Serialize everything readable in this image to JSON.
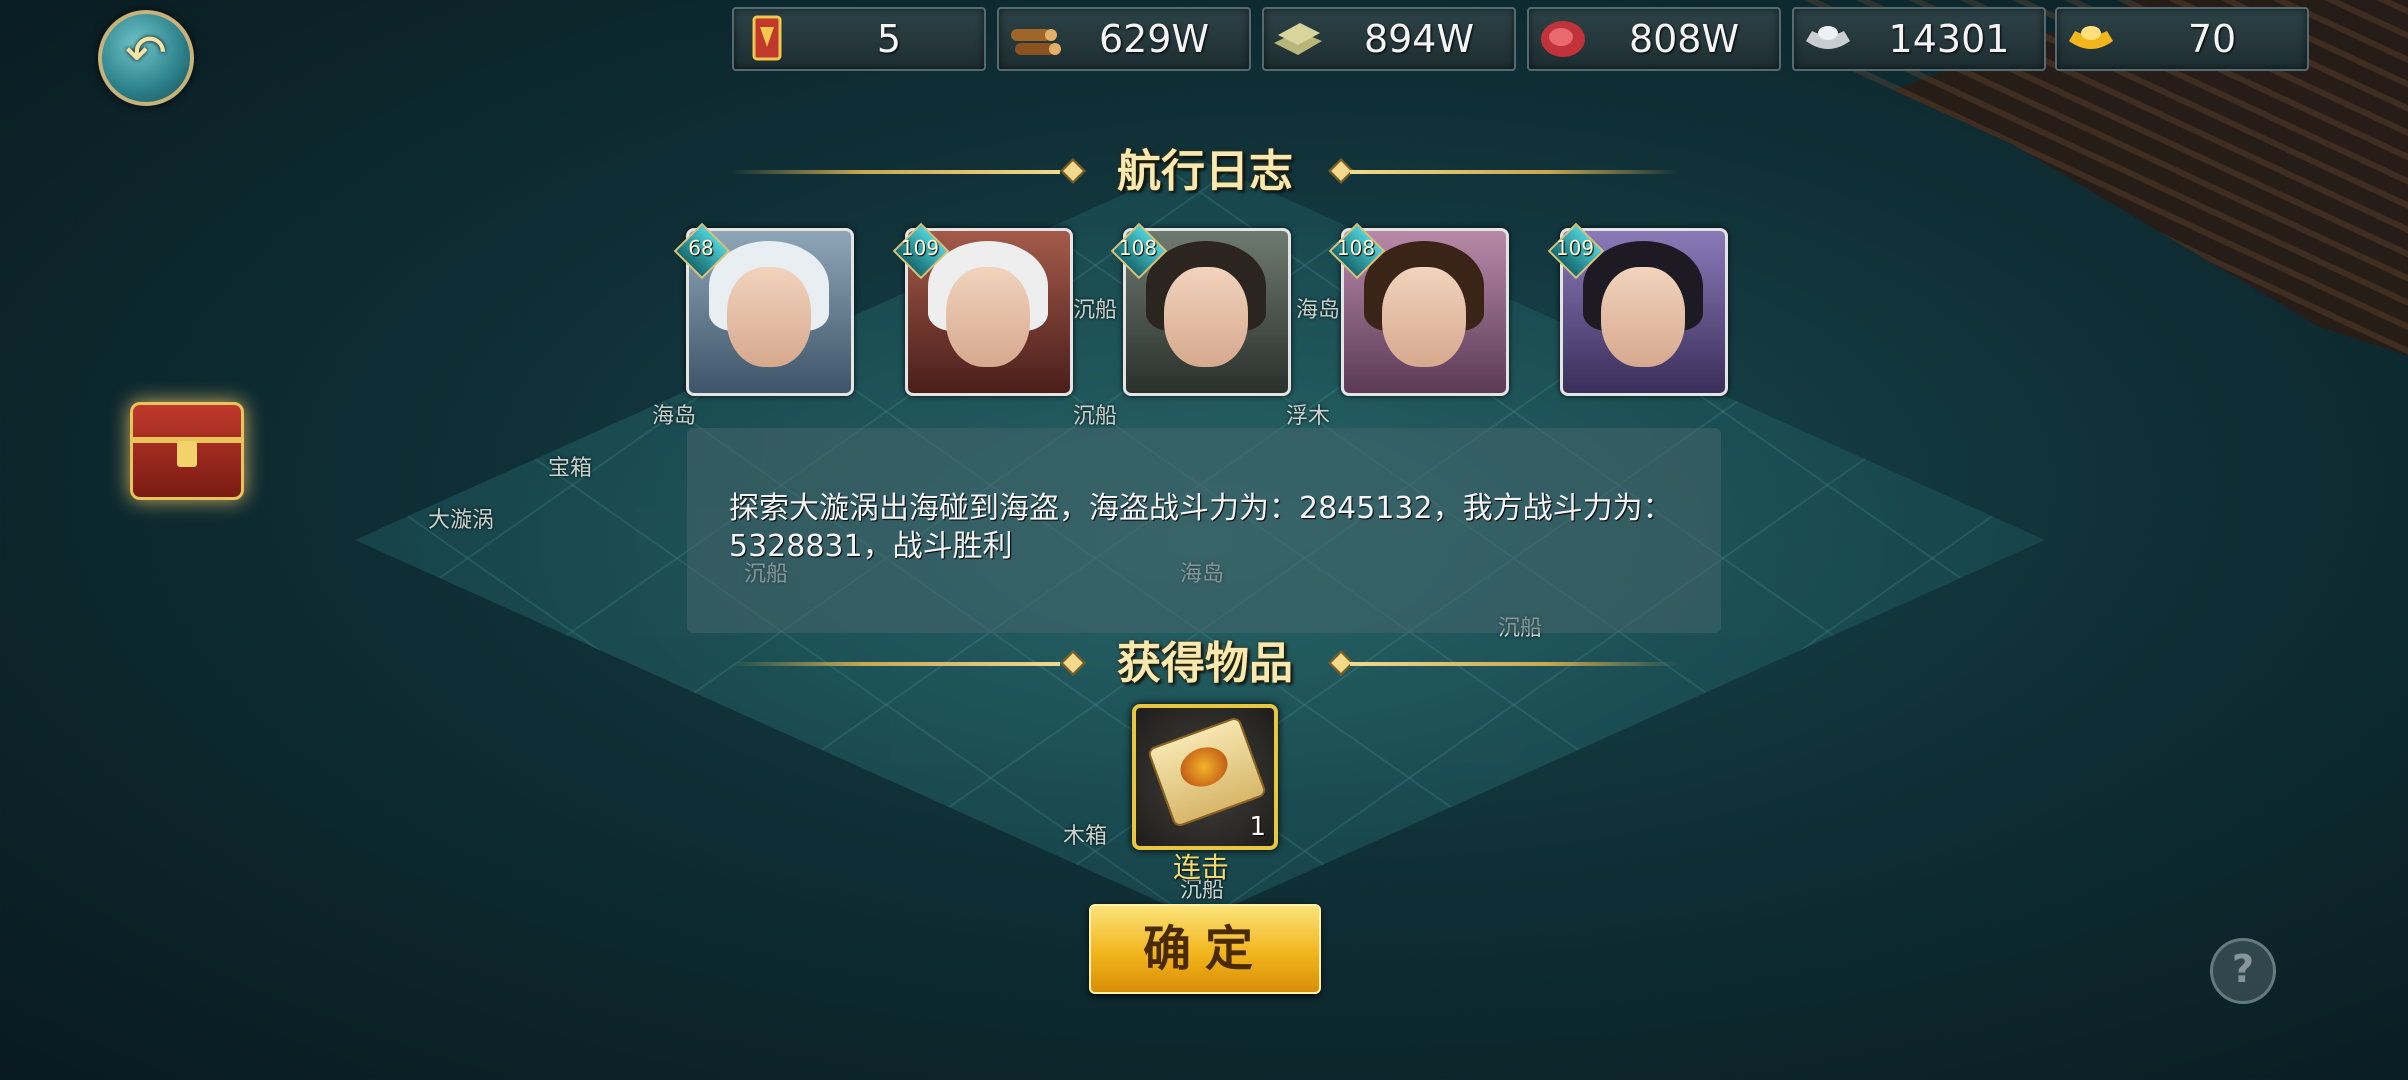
{
  "resources": [
    {
      "icon": "token-icon",
      "value": "5"
    },
    {
      "icon": "wood-icon",
      "value": "629W"
    },
    {
      "icon": "stone-icon",
      "value": "894W"
    },
    {
      "icon": "meat-icon",
      "value": "808W"
    },
    {
      "icon": "silver-icon",
      "value": "14301"
    },
    {
      "icon": "gold-icon",
      "value": "70"
    }
  ],
  "voyage_log": {
    "title": "航行日志",
    "heroes": [
      {
        "level": "68"
      },
      {
        "level": "109"
      },
      {
        "level": "108"
      },
      {
        "level": "108"
      },
      {
        "level": "109"
      }
    ],
    "message": "探索大漩涡出海碰到海盗，海盗战斗力为：2845132，我方战斗力为：5328831，战斗胜利"
  },
  "rewards": {
    "title": "获得物品",
    "item": {
      "name": "连击",
      "count": "1"
    }
  },
  "confirm_label": "确定",
  "help_label": "?",
  "back_label": "↶",
  "board_labels": [
    "海岛",
    "宝箱",
    "大漩涡",
    "沉船",
    "沉船",
    "海岛",
    "浮木",
    "海岛",
    "沉船",
    "沉船",
    "木箱",
    "沉船"
  ]
}
